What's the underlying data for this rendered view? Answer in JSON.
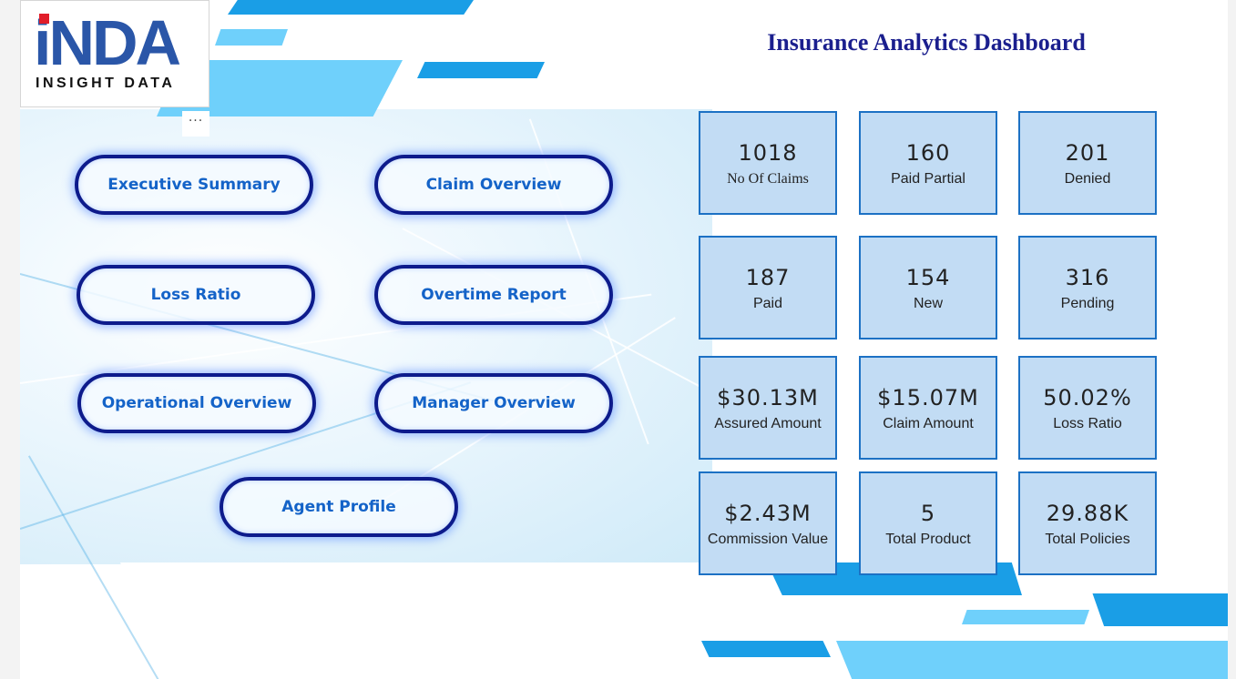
{
  "logo": {
    "mark": "iNDA",
    "subtitle": "INSIGHT DATA"
  },
  "more_options": "···",
  "title": "Insurance Analytics Dashboard",
  "nav_buttons": [
    {
      "label": "Executive Summary"
    },
    {
      "label": "Claim Overview"
    },
    {
      "label": "Loss Ratio"
    },
    {
      "label": "Overtime Report"
    },
    {
      "label": "Operational Overview"
    },
    {
      "label": "Manager Overview"
    },
    {
      "label": "Agent Profile"
    }
  ],
  "kpis": [
    {
      "value": "1018",
      "label": "No Of Claims"
    },
    {
      "value": "160",
      "label": "Paid Partial"
    },
    {
      "value": "201",
      "label": "Denied"
    },
    {
      "value": "187",
      "label": "Paid"
    },
    {
      "value": "154",
      "label": "New"
    },
    {
      "value": "316",
      "label": "Pending"
    },
    {
      "value": "$30.13M",
      "label": "Assured Amount"
    },
    {
      "value": "$15.07M",
      "label": "Claim Amount"
    },
    {
      "value": "50.02%",
      "label": "Loss Ratio"
    },
    {
      "value": "$2.43M",
      "label": "Commission Value"
    },
    {
      "value": "5",
      "label": "Total Product"
    },
    {
      "value": "29.88K",
      "label": "Total Policies"
    }
  ],
  "colors": {
    "title": "#1b1f8e",
    "nav_border": "#0d1b8c",
    "nav_text": "#1463c8",
    "card_fill": "#c2dcf4",
    "card_border": "#1c71c4",
    "accent_blue": "#1a9ee6",
    "light_blue": "#6fd0fb",
    "logo_red": "#e11d2a",
    "logo_blue": "#2a56a8"
  }
}
